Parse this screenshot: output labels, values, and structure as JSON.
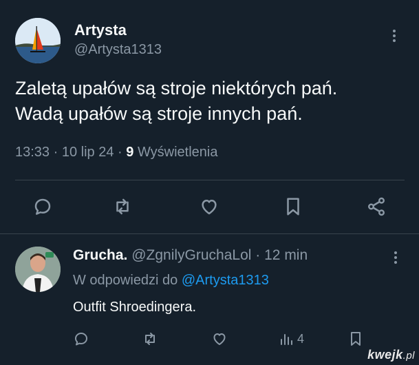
{
  "post": {
    "author_name": "Artysta",
    "author_handle": "@Artysta1313",
    "text_line1": "Zaletą upałów są stroje niektórych pań.",
    "text_line2": "Wadą upałów są stroje innych pań.",
    "time": "13:33",
    "date": "10 lip 24",
    "views_count": "9",
    "views_label": "Wyświetlenia",
    "sep": "·"
  },
  "reply": {
    "author_name": "Grucha.",
    "author_handle": "@ZgnilyGruchaLol",
    "age": "12 min",
    "sep": "·",
    "replying_prefix": "W odpowiedzi do",
    "replying_to": "@Artysta1313",
    "text": "Outfit Shroedingera.",
    "views_count": "4"
  },
  "watermark": {
    "main": "kwejk",
    "suffix": ".pl"
  },
  "colors": {
    "background": "#15202b",
    "text": "#f7f9f9",
    "muted": "#8b98a5",
    "link": "#1d9bf0",
    "divider": "#38444d"
  }
}
